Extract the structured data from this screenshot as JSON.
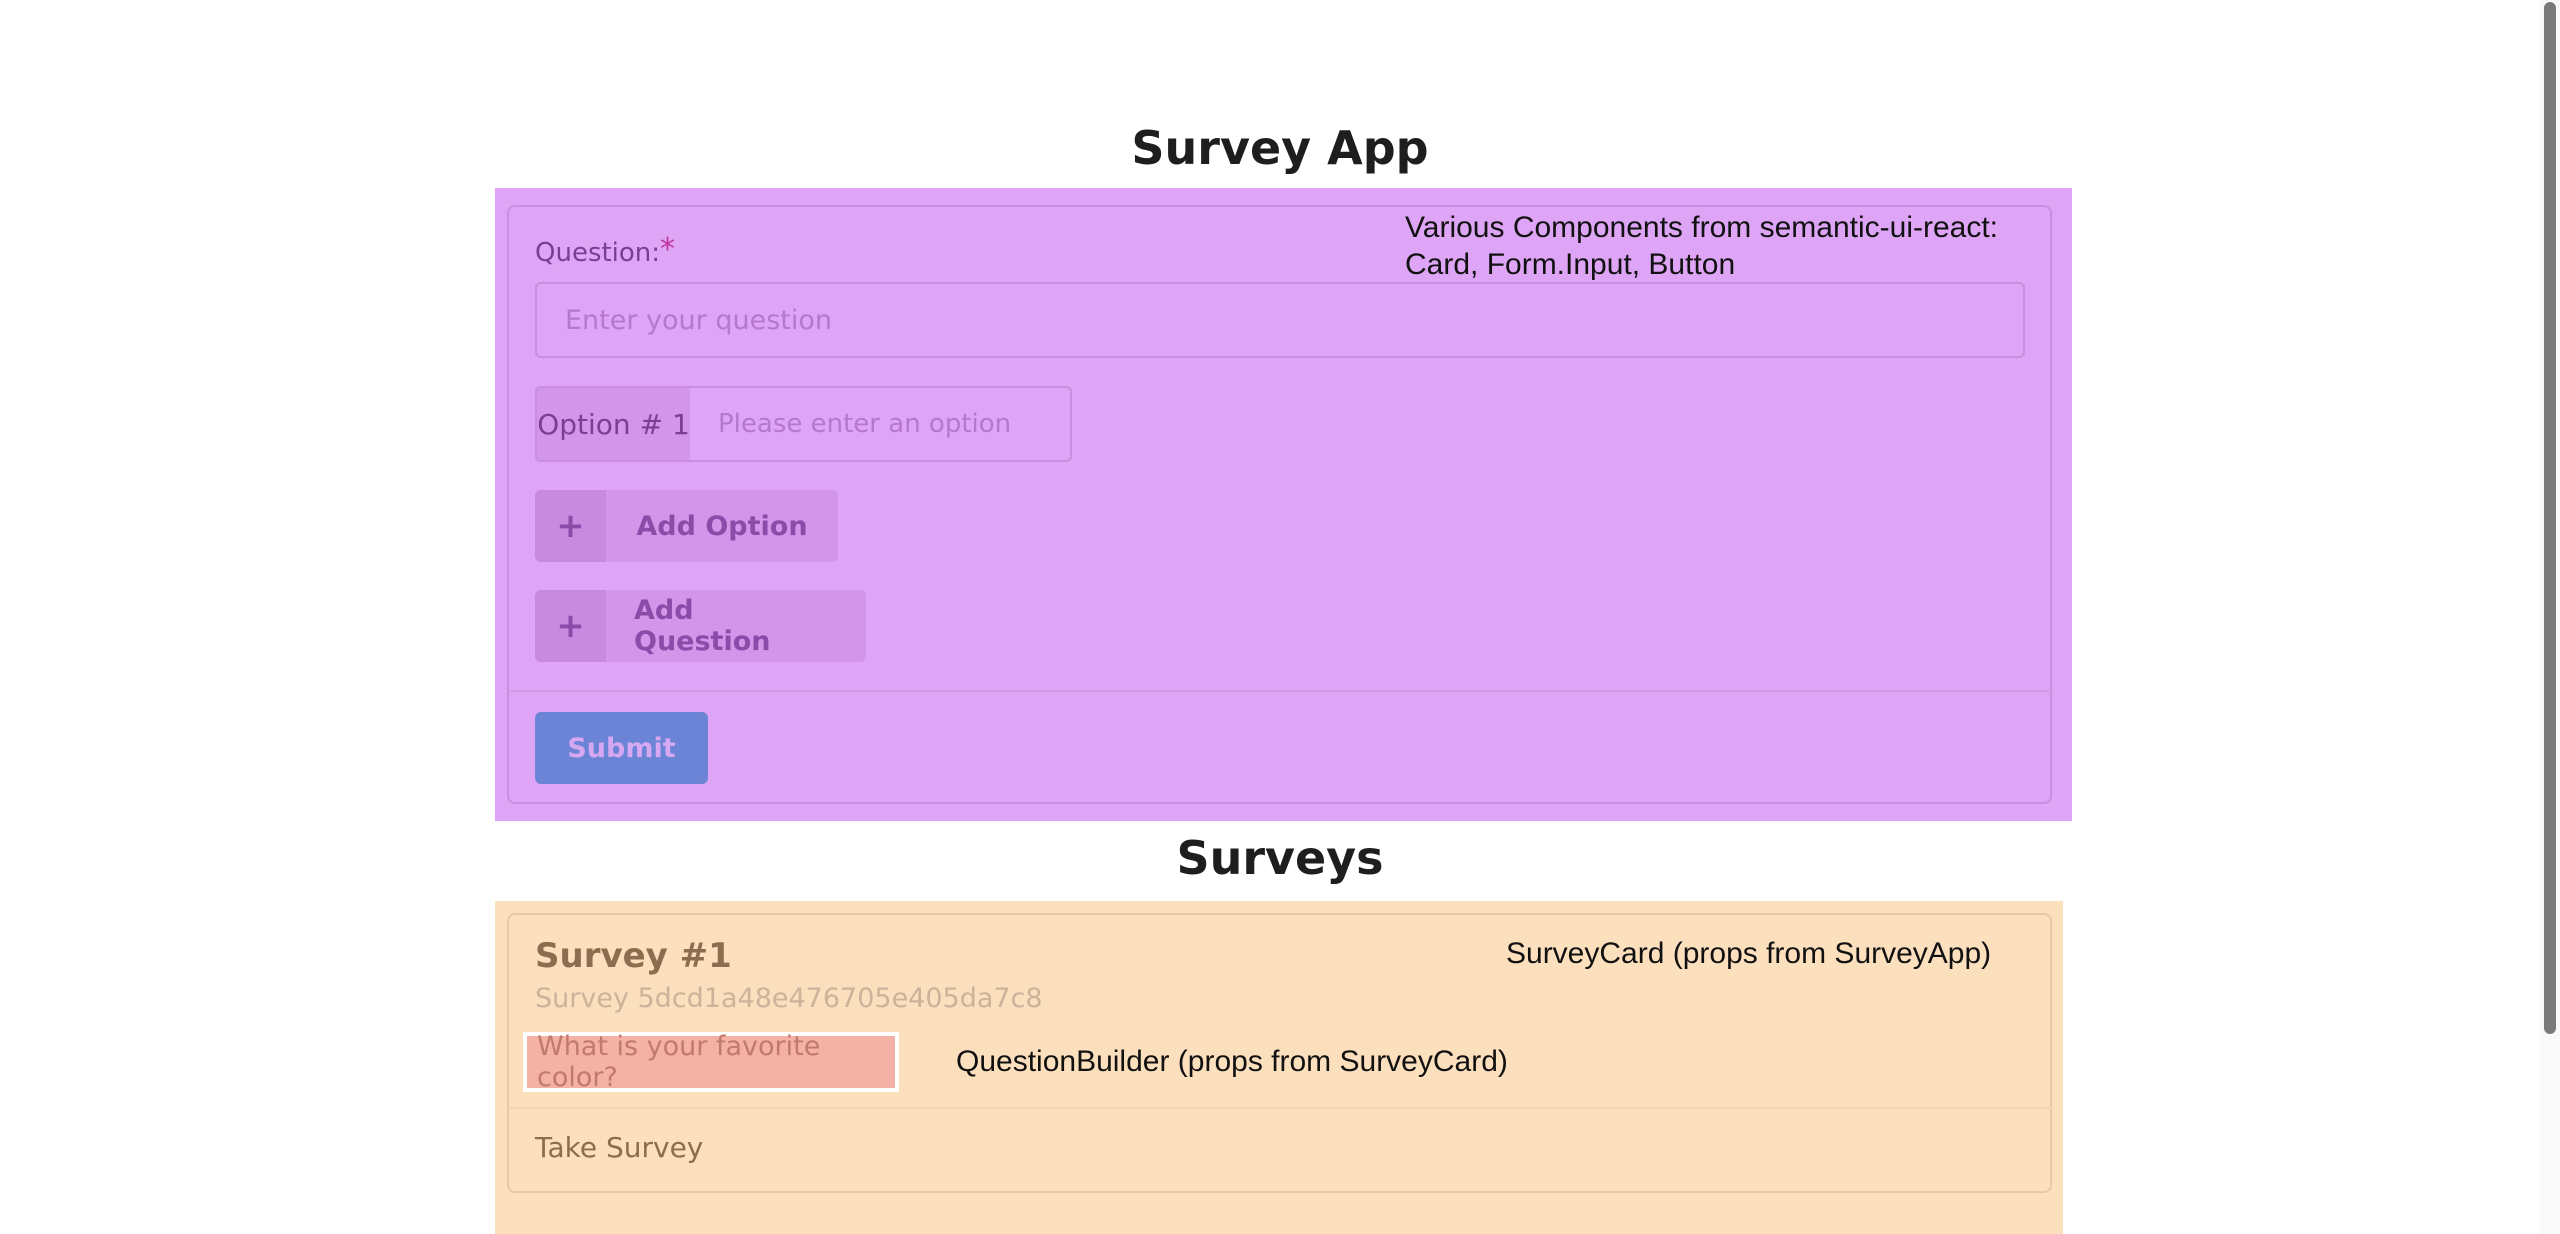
{
  "app": {
    "title": "Survey App"
  },
  "builder": {
    "annotation": "Various Components from semantic-ui-react:",
    "annotation_line2": "Card, Form.Input, Button",
    "question_label": "Question:",
    "required_mark": "*",
    "question_placeholder": "Enter your question",
    "option_label": "Option # 1",
    "option_placeholder": "Please enter an option",
    "add_option_icon": "+",
    "add_option_label": "Add Option",
    "add_question_icon": "+",
    "add_question_label": "Add Question",
    "submit_label": "Submit",
    "colors": {
      "overlay": "#dea4f5",
      "submit": "#6b84d6"
    }
  },
  "surveys": {
    "title": "Surveys",
    "card_annotation": "SurveyCard (props from SurveyApp)",
    "question_annotation": "QuestionBuilder (props from SurveyCard)",
    "items": [
      {
        "title": "Survey #1",
        "meta": "Survey 5dcd1a48e476705e405da7c8",
        "question": "What is your favorite color?",
        "action": "Take Survey"
      }
    ],
    "colors": {
      "overlay": "#fcdfbd",
      "question_chip": "#f4b1a5"
    }
  },
  "icons": [
    "plus-icon",
    "plus-icon"
  ]
}
